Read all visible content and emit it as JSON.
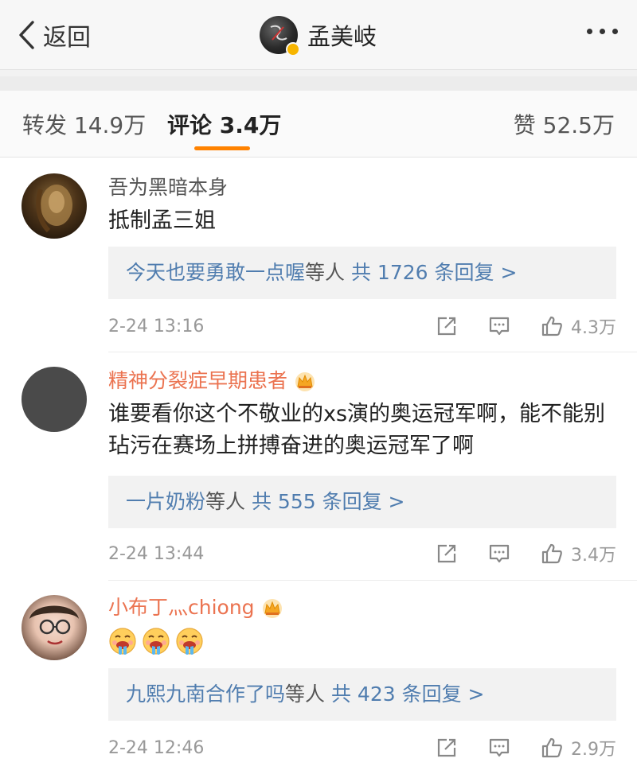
{
  "nav": {
    "back_label": "返回",
    "title": "孟美岐"
  },
  "tabs": {
    "repost": "转发 14.9万",
    "comment": "评论 3.4万",
    "like": "赞 52.5万"
  },
  "comments": [
    {
      "user": "吾为黑暗本身",
      "text": "抵制孟三姐",
      "reply_users": "今天也要勇敢一点喔",
      "reply_mid": "等人",
      "reply_count": "共 1726 条回复 >",
      "time": "2-24 13:16",
      "likes": "4.3万"
    },
    {
      "user": "精神分裂症早期患者",
      "text": "谁要看你这个不敬业的xs演的奥运冠军啊，能不能别玷污在赛场上拼搏奋进的奥运冠军了啊",
      "reply_users": "一片奶粉",
      "reply_mid": "等人",
      "reply_count": "共 555 条回复 >",
      "time": "2-24 13:44",
      "likes": "3.4万"
    },
    {
      "user": "小布丁灬chiong",
      "reply_users": "九熙九南合作了吗",
      "reply_mid": "等人",
      "reply_count": "共 423 条回复 >",
      "time": "2-24 12:46",
      "likes": "2.9万"
    }
  ],
  "colors": {
    "accent": "#ff8200",
    "vip_name": "#eb7350",
    "link": "#507daf",
    "meta": "#999999"
  },
  "icons": [
    "chevron-left-icon",
    "verified-badge-icon",
    "more-dots-icon",
    "crown-icon",
    "share-icon",
    "comment-icon",
    "thumbs-up-icon",
    "drooling-emoji-icon"
  ]
}
